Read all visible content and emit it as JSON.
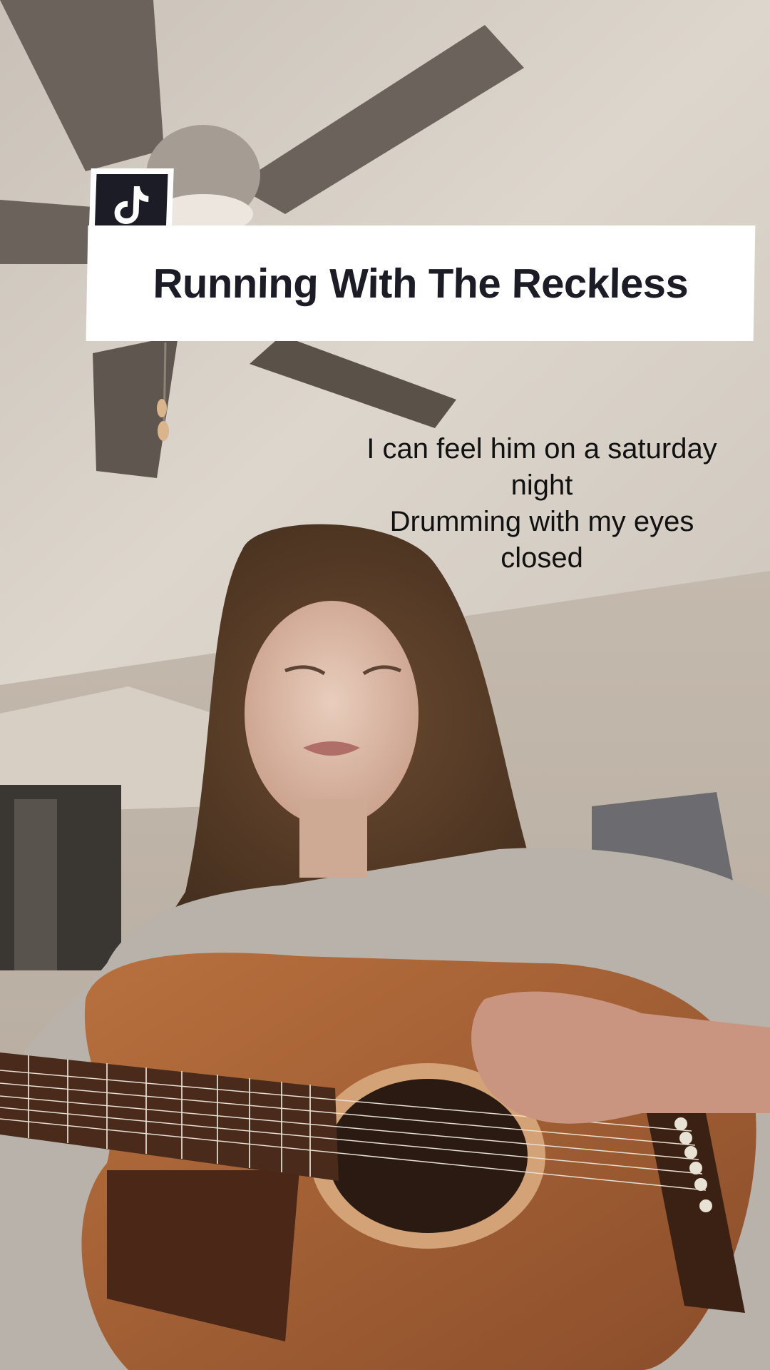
{
  "video": {
    "song_title": "Running With The Reckless",
    "logo_icon": "tiktok-logo-icon",
    "lyrics": [
      "I can feel him on a saturday",
      "night",
      "Drumming with my eyes",
      "closed"
    ]
  },
  "colors": {
    "title_text": "#1b1c25",
    "title_card": "#ffffff",
    "lyric_text": "#111111"
  }
}
